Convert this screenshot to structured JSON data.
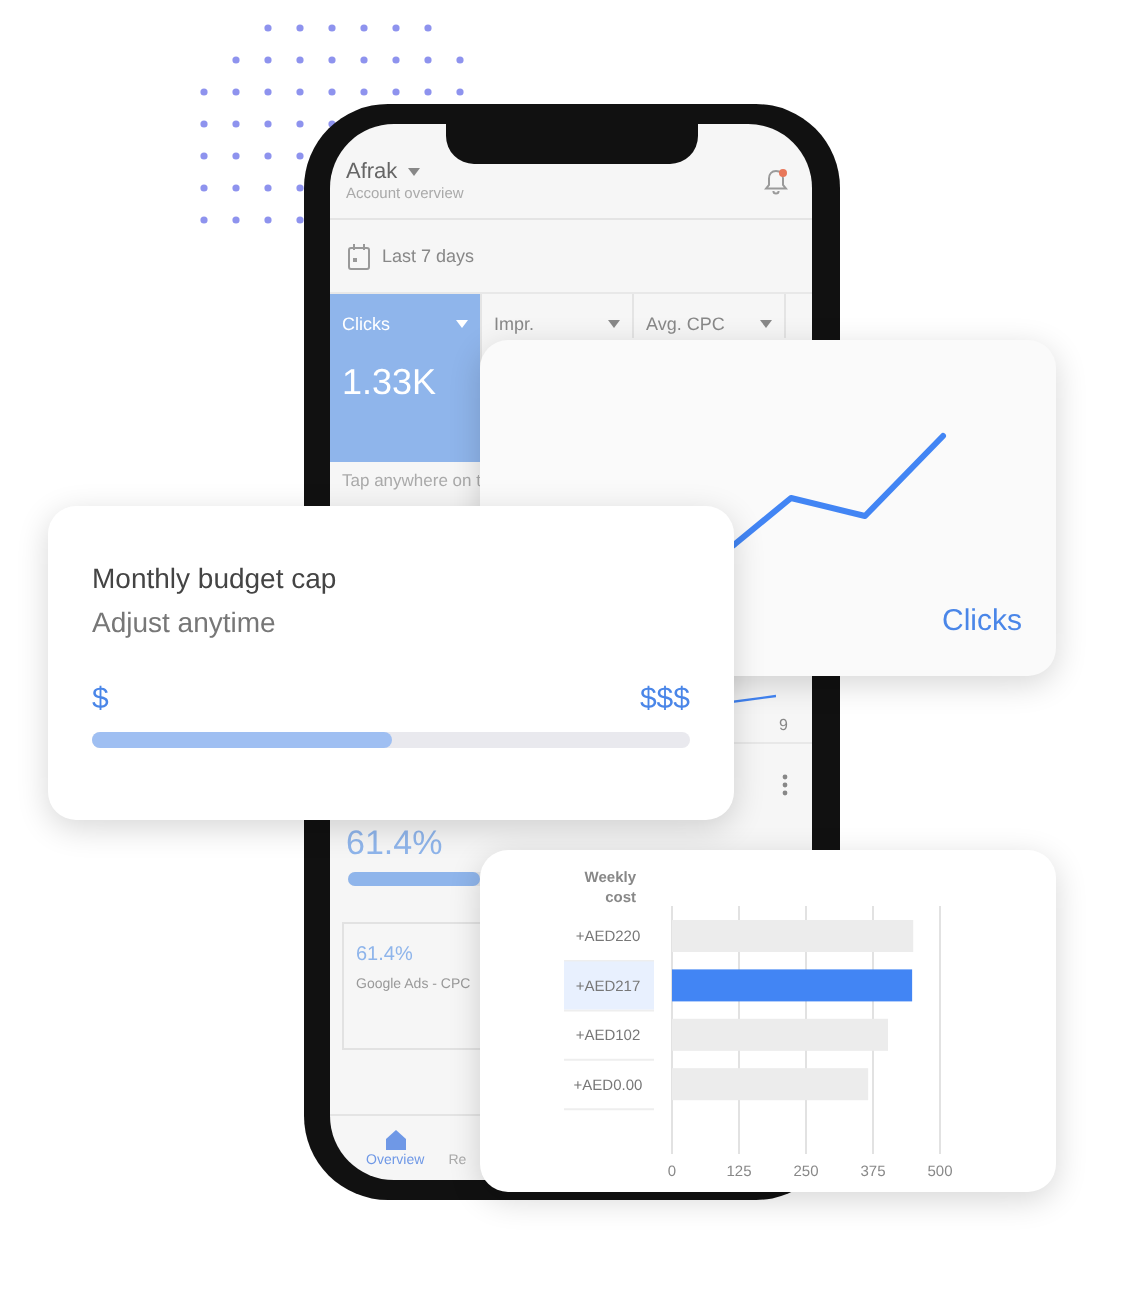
{
  "phone": {
    "account": "Afrak",
    "subtitle": "Account overview",
    "notification": true,
    "date_range": "Last 7 days",
    "metric_tabs": [
      {
        "label": "Clicks",
        "value": "1.33K",
        "selected": true
      },
      {
        "label": "Impr.",
        "selected": false
      },
      {
        "label": "Avg. CPC",
        "selected": false
      }
    ],
    "hint": "Tap anywhere on t",
    "axis_label": "9",
    "share": {
      "value": "61.4%",
      "level": 0.6
    },
    "sub_card": {
      "value": "61.4%",
      "label": "Google Ads - CPC"
    },
    "nav": [
      {
        "label": "Overview",
        "selected": true
      },
      {
        "label": "Re",
        "selected": false
      }
    ]
  },
  "clicks_card": {
    "label": "Clicks"
  },
  "budget_card": {
    "title": "Monthly budget cap",
    "subtitle": "Adjust anytime",
    "min_label": "$",
    "max_label": "$$$",
    "level": 0.5
  },
  "cost_card": {
    "rows": [
      {
        "selected": false
      },
      {
        "selected": true
      },
      {
        "selected": false
      },
      {
        "selected": false
      }
    ],
    "chart_data": {
      "type": "bar",
      "orientation": "horizontal",
      "grid": true,
      "categories": [
        "+AED220",
        "+AED217",
        "+AED102",
        "+AED0.00"
      ],
      "series": [
        {
          "name": "Weekly cost",
          "values": [
            450,
            448,
            403,
            366
          ]
        }
      ],
      "xlim": [
        0,
        500
      ],
      "xticks": [
        0,
        125,
        250,
        375,
        500
      ]
    }
  }
}
